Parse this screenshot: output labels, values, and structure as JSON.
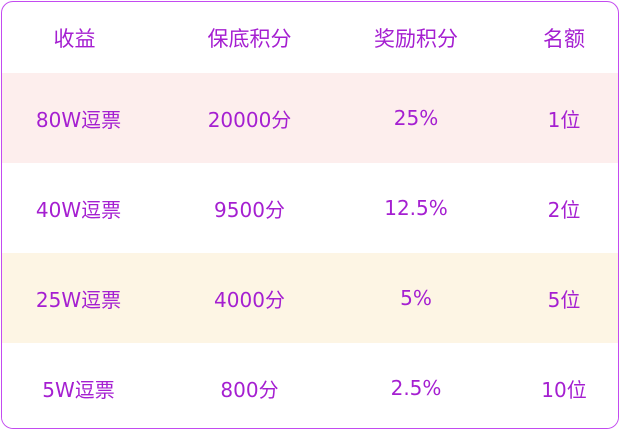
{
  "table": {
    "headers": [
      "收益",
      "保底积分",
      "奖励积分",
      "名额"
    ],
    "rows": [
      [
        "80W逗票",
        "20000分",
        "25%",
        "1位"
      ],
      [
        "40W逗票",
        "9500分",
        "12.5%",
        "2位"
      ],
      [
        "25W逗票",
        "4000分",
        "5%",
        "5位"
      ],
      [
        "5W逗票",
        "800分",
        "2.5%",
        "10位"
      ]
    ]
  },
  "colors": {
    "border": "#c34bf0",
    "text": "#a51fd1",
    "row_highlight_pink": "#fdeeed",
    "row_highlight_cream": "#fdf5e4",
    "row_plain": "#ffffff"
  }
}
